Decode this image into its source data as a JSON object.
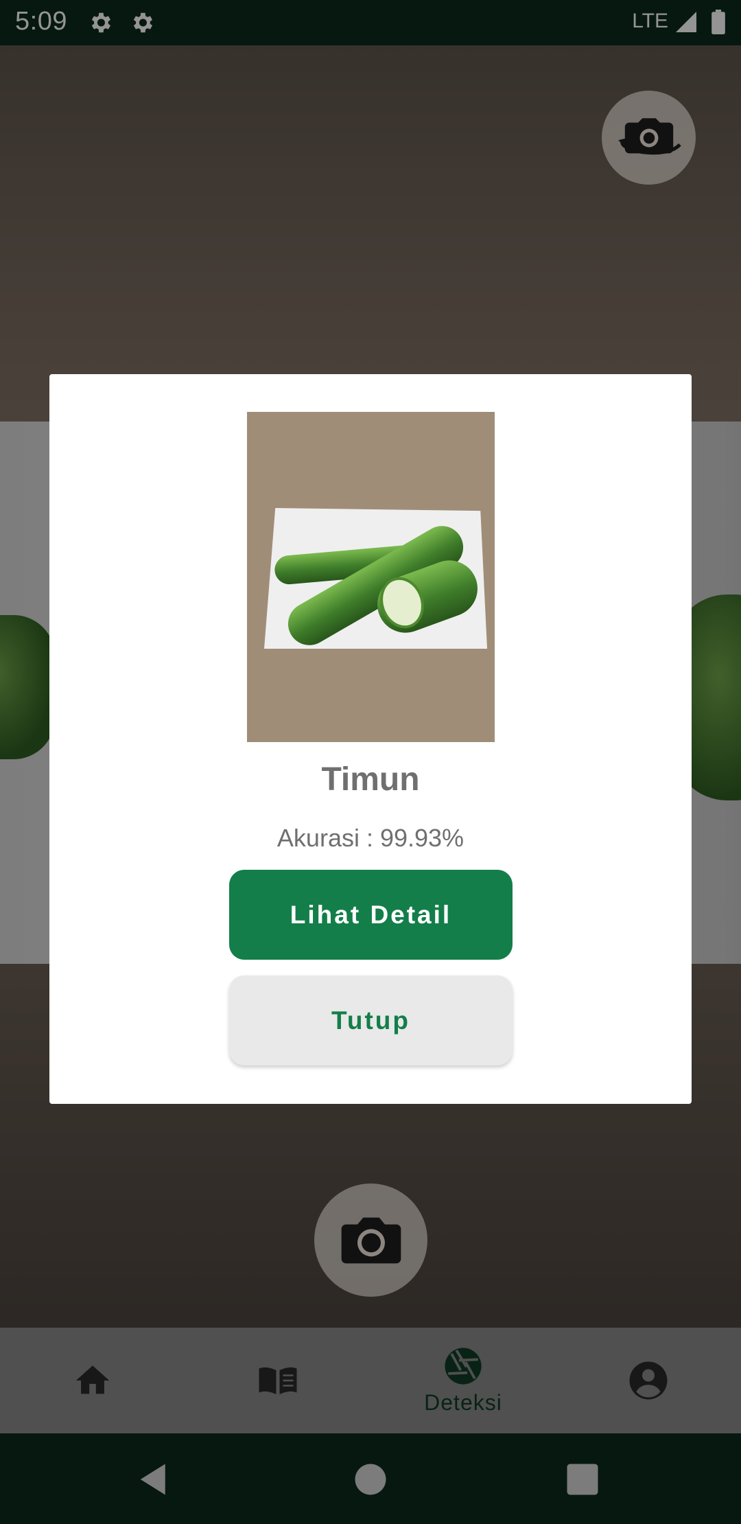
{
  "status_bar": {
    "time": "5:09",
    "network": "LTE",
    "icons": [
      "settings-gear-icon",
      "settings-gear-icon",
      "signal-icon",
      "battery-icon"
    ]
  },
  "camera": {
    "switch_icon": "camera-switch-icon",
    "capture_icon": "camera-icon"
  },
  "dialog": {
    "result_name": "Timun",
    "accuracy": "Akurasi : 99.93%",
    "detail_button": "Lihat Detail",
    "close_button": "Tutup"
  },
  "bottom_nav": {
    "items": [
      {
        "icon": "home-icon",
        "label": ""
      },
      {
        "icon": "book-icon",
        "label": ""
      },
      {
        "icon": "aperture-icon",
        "label": "Deteksi",
        "active": true
      },
      {
        "icon": "account-icon",
        "label": ""
      }
    ]
  },
  "colors": {
    "primary": "#137e49",
    "status_bar": "#0b2a1c",
    "text_muted": "#6f6f6f"
  }
}
